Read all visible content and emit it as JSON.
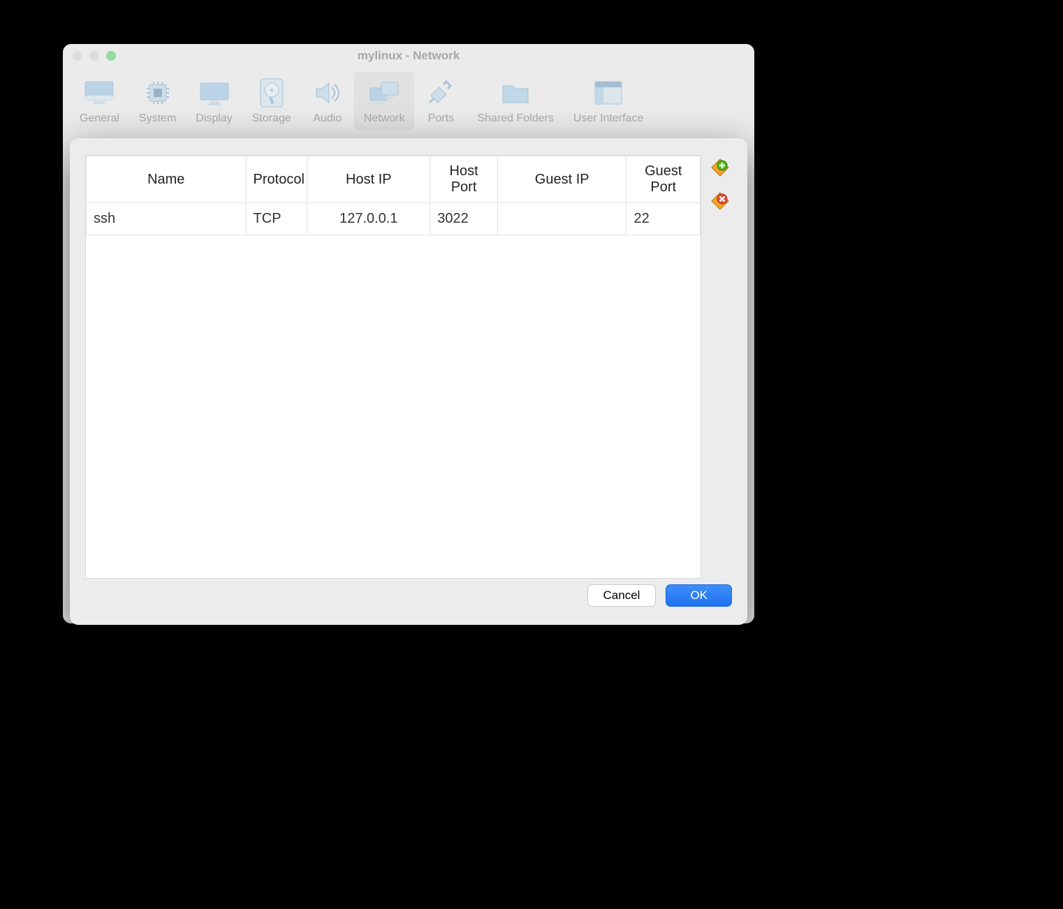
{
  "window": {
    "title": "mylinux - Network"
  },
  "toolbar": {
    "items": [
      {
        "label": "General"
      },
      {
        "label": "System"
      },
      {
        "label": "Display"
      },
      {
        "label": "Storage"
      },
      {
        "label": "Audio"
      },
      {
        "label": "Network"
      },
      {
        "label": "Ports"
      },
      {
        "label": "Shared Folders"
      },
      {
        "label": "User Interface"
      }
    ],
    "active_index": 5
  },
  "port_table": {
    "columns": [
      "Name",
      "Protocol",
      "Host IP",
      "Host Port",
      "Guest IP",
      "Guest Port"
    ],
    "rows": [
      {
        "name": "ssh",
        "protocol": "TCP",
        "host_ip": "127.0.0.1",
        "host_port": "3022",
        "guest_ip": "",
        "guest_port": "22"
      }
    ]
  },
  "buttons": {
    "cancel": "Cancel",
    "ok": "OK"
  }
}
